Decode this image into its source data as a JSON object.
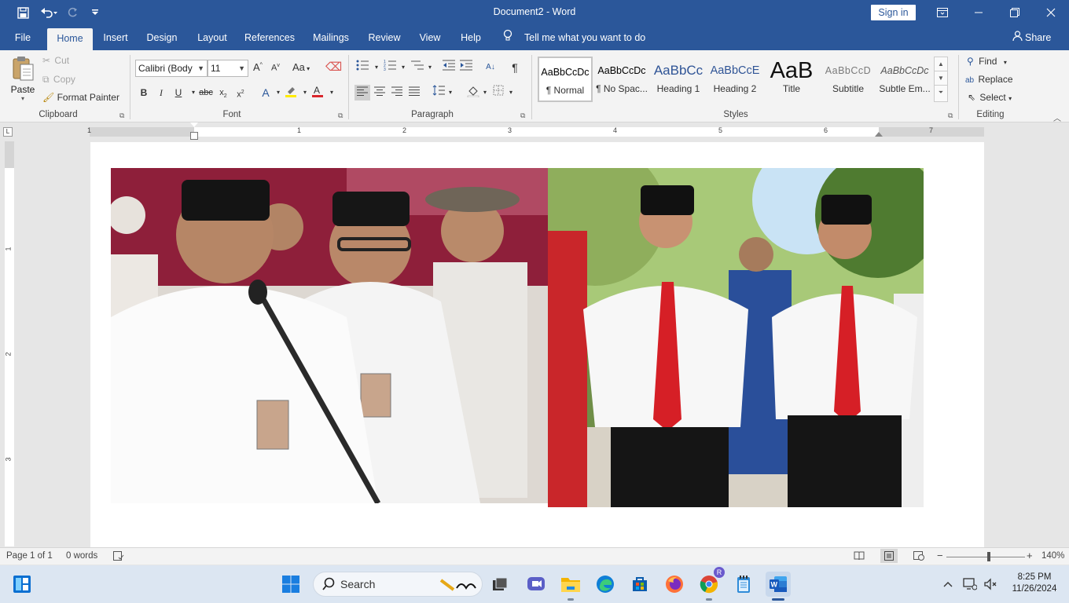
{
  "titlebar": {
    "title": "Document2  -  Word",
    "sign_in_label": "Sign in"
  },
  "tabs": {
    "file": "File",
    "home": "Home",
    "insert": "Insert",
    "design": "Design",
    "layout": "Layout",
    "references": "References",
    "mailings": "Mailings",
    "review": "Review",
    "view": "View",
    "help": "Help",
    "tell_me": "Tell me what you want to do",
    "share": "Share"
  },
  "clipboard": {
    "group_label": "Clipboard",
    "paste": "Paste",
    "cut": "Cut",
    "copy": "Copy",
    "format_painter": "Format Painter"
  },
  "font": {
    "group_label": "Font",
    "font_name": "Calibri (Body",
    "font_size": "11",
    "change_case": "Aa"
  },
  "paragraph": {
    "group_label": "Paragraph"
  },
  "styles": {
    "group_label": "Styles",
    "items": [
      {
        "preview": "AaBbCcDc",
        "name": "¶ Normal"
      },
      {
        "preview": "AaBbCcDc",
        "name": "¶ No Spac..."
      },
      {
        "preview": "AaBbCc",
        "name": "Heading 1"
      },
      {
        "preview": "AaBbCcE",
        "name": "Heading 2"
      },
      {
        "preview": "AaB",
        "name": "Title"
      },
      {
        "preview": "AaBbCcD",
        "name": "Subtitle"
      },
      {
        "preview": "AaBbCcDc",
        "name": "Subtle Em..."
      }
    ]
  },
  "editing": {
    "group_label": "Editing",
    "find": "Find",
    "replace": "Replace",
    "select": "Select"
  },
  "ruler": {
    "numbers": [
      "1",
      "1",
      "2",
      "3",
      "4",
      "5",
      "6",
      "7"
    ],
    "vertical_numbers": [
      "1",
      "2",
      "3"
    ]
  },
  "status": {
    "page": "Page 1 of 1",
    "words": "0 words",
    "zoom": "140%"
  },
  "taskbar": {
    "search_label": "Search",
    "time": "8:25 PM",
    "date": "11/26/2024",
    "chrome_badge": "R"
  },
  "colors": {
    "word_blue": "#2b579a",
    "ribbon_bg": "#f3f3f3",
    "taskbar_bg": "#dce6f2"
  }
}
